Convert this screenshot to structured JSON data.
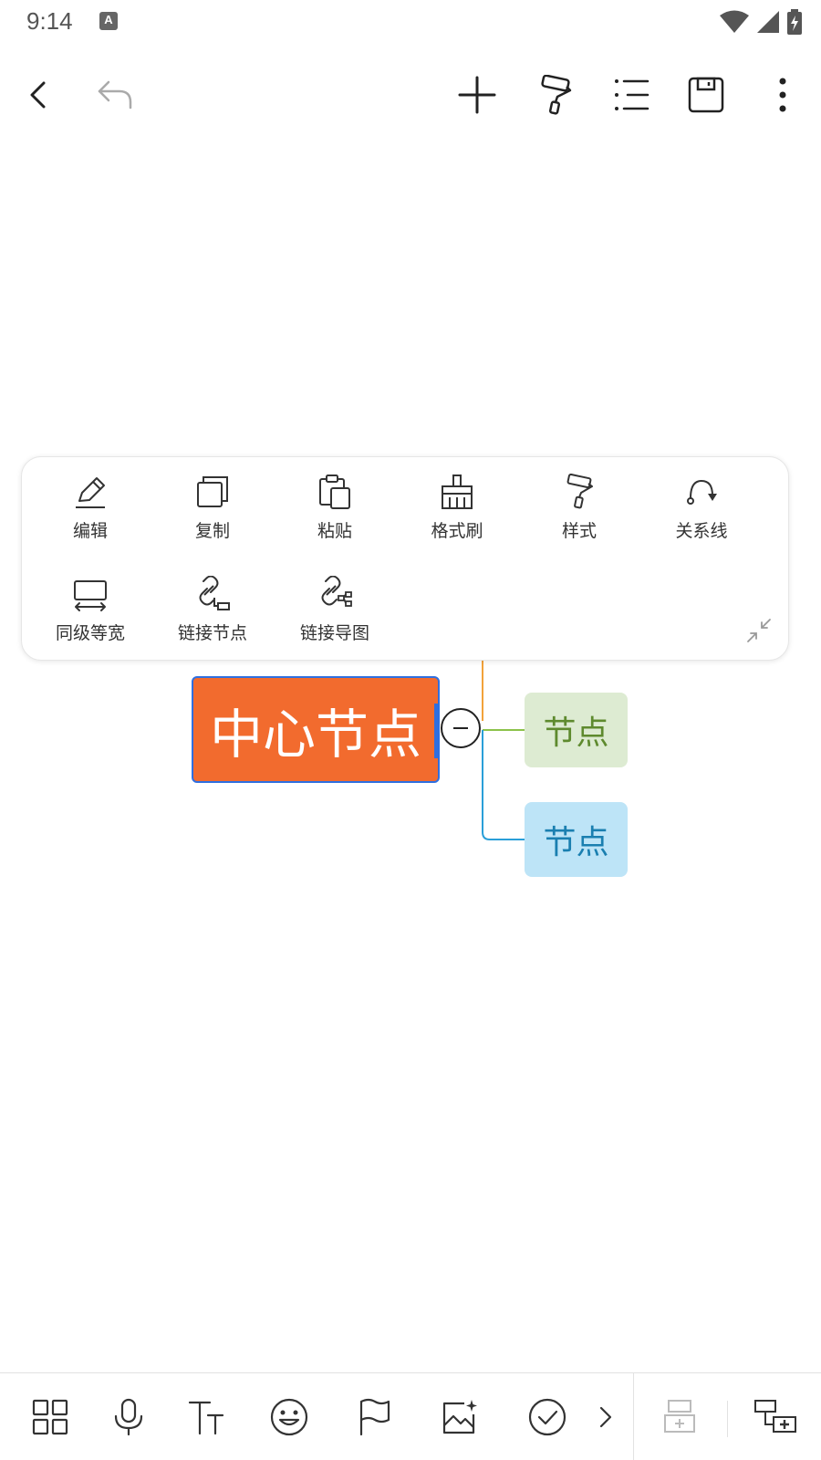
{
  "status_bar": {
    "time": "9:14",
    "notification_icon": "A"
  },
  "top_bar": {
    "icons": [
      "back-icon",
      "undo-icon",
      "add-icon",
      "format-painter-icon",
      "outline-list-icon",
      "save-icon",
      "more-vert-icon"
    ]
  },
  "context_menu": {
    "items": [
      {
        "label": "编辑",
        "icon": "pencil-icon"
      },
      {
        "label": "复制",
        "icon": "copy-icon"
      },
      {
        "label": "粘贴",
        "icon": "paste-icon"
      },
      {
        "label": "格式刷",
        "icon": "format-brush-icon"
      },
      {
        "label": "样式",
        "icon": "paint-roller-icon"
      },
      {
        "label": "关系线",
        "icon": "relation-line-icon"
      },
      {
        "label": "同级等宽",
        "icon": "equal-width-icon"
      },
      {
        "label": "链接节点",
        "icon": "link-node-icon"
      },
      {
        "label": "链接导图",
        "icon": "link-map-icon"
      }
    ]
  },
  "mind_map": {
    "central_node": "中心节点",
    "child_nodes": [
      "节点",
      "节点"
    ],
    "colors": {
      "central_fill": "#f26b2e",
      "selection": "#2f6fe0",
      "green_fill": "#ddebd2",
      "green_text": "#5e8a2e",
      "blue_fill": "#bde4f7",
      "blue_text": "#1a7fb0",
      "orange_line": "#f2a23a",
      "green_line": "#8cc24a",
      "blue_line": "#2a9fd8"
    }
  },
  "bottom_bar": {
    "icons": [
      "layout-grid-icon",
      "microphone-icon",
      "text-size-icon",
      "emoji-icon",
      "flag-icon",
      "image-icon",
      "check-circle-icon",
      "chevron-right-icon",
      "insert-sibling-icon",
      "insert-child-icon"
    ]
  }
}
